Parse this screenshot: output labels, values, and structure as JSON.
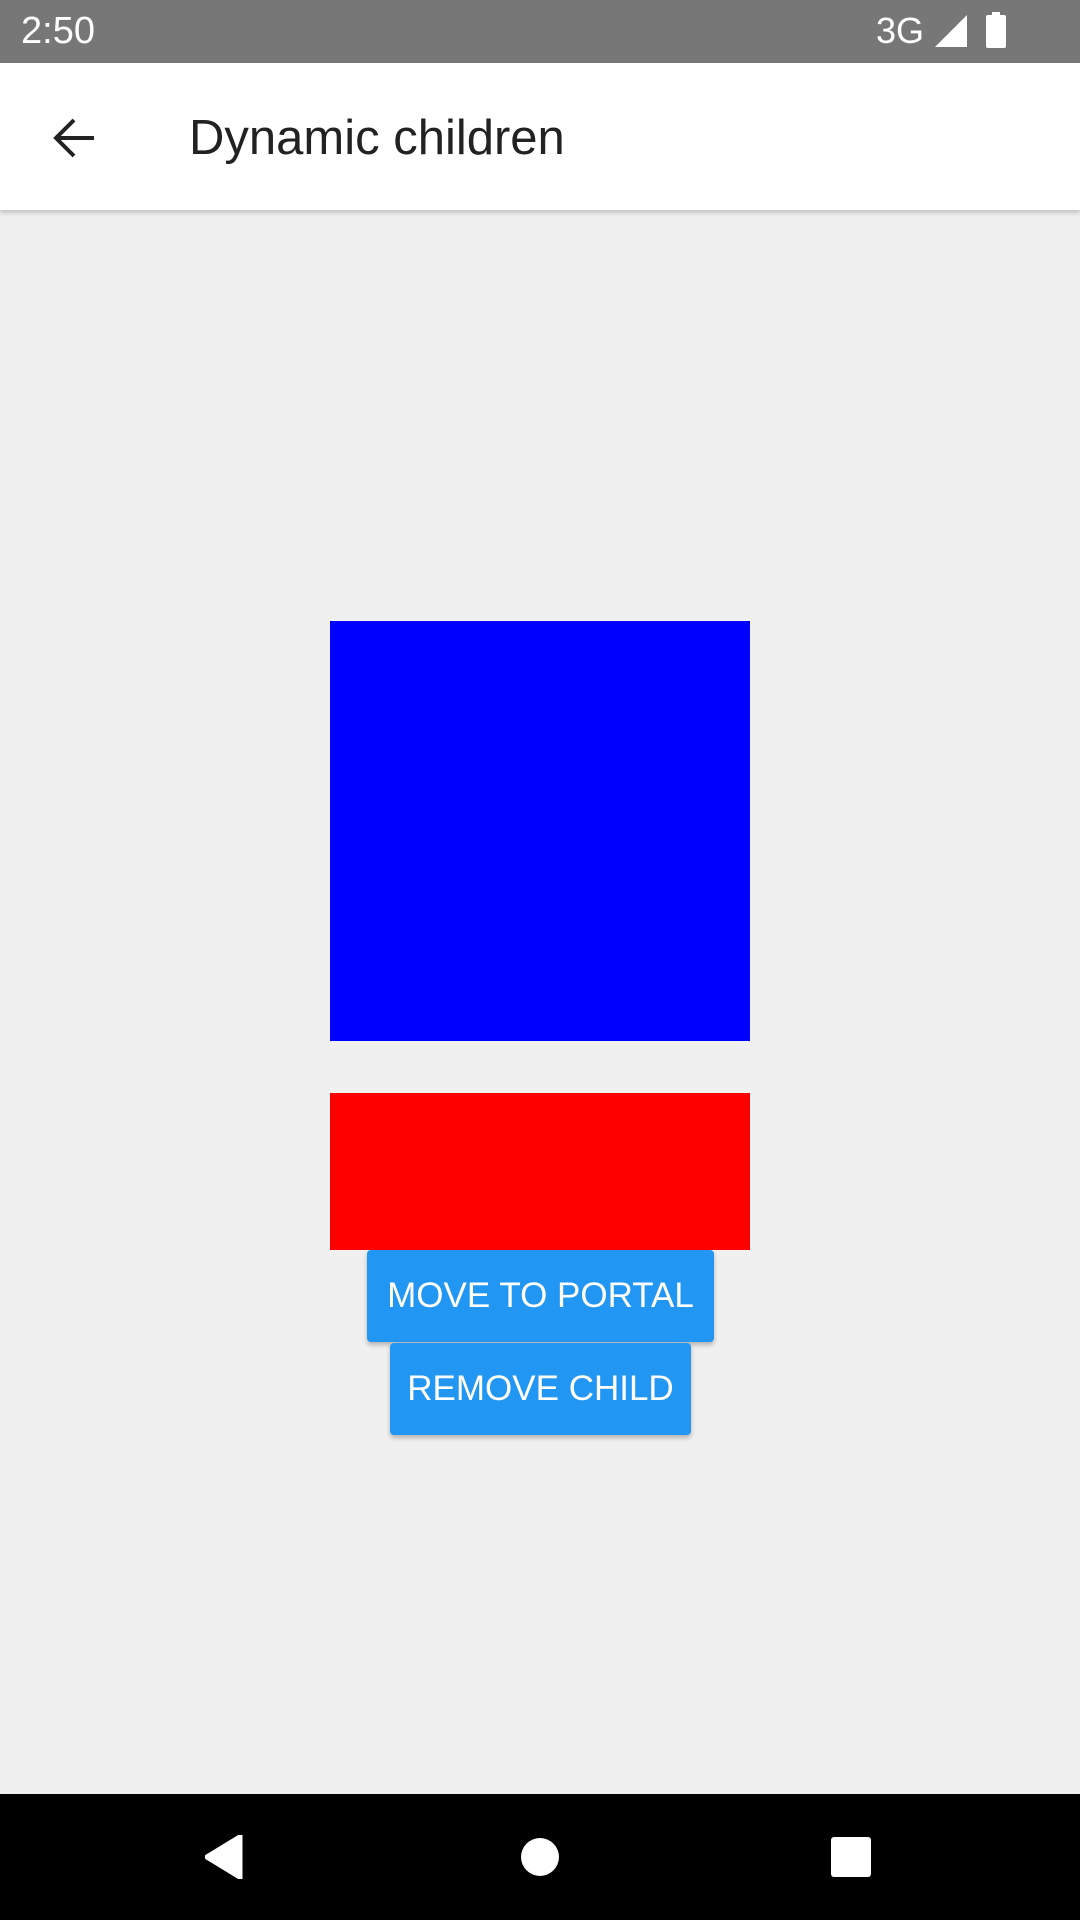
{
  "status_bar": {
    "time": "2:50",
    "network": "3G",
    "icons": [
      "signal-icon",
      "battery-icon"
    ]
  },
  "app_bar": {
    "title": "Dynamic children",
    "back_icon": "arrow-back-icon"
  },
  "content": {
    "blue_box_color": "#0000ff",
    "red_box_color": "#ff0000",
    "buttons": {
      "move_to_portal": "MOVE TO PORTAL",
      "remove_child": "REMOVE CHILD"
    },
    "button_color": "#2196f3"
  },
  "nav_bar": {
    "icons": [
      "nav-back-icon",
      "nav-home-icon",
      "nav-recents-icon"
    ]
  }
}
